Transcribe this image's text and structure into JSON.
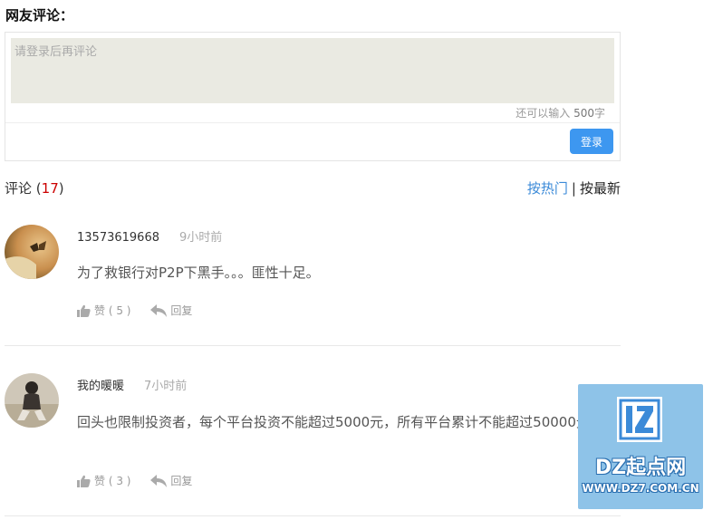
{
  "section": {
    "title": "网友评论："
  },
  "composer": {
    "placeholder": "请登录后再评论",
    "limit_prefix": "还可以输入",
    "limit_count": "500",
    "limit_suffix": "字",
    "login_label": "登录"
  },
  "comments_header": {
    "label": "评论",
    "count": "17",
    "sort_hot": "按热门",
    "sort_sep": "|",
    "sort_new": "按最新"
  },
  "comments": [
    {
      "user": "13573619668",
      "time": "9小时前",
      "text": "为了救银行对P2P下黑手。。。匪性十足。",
      "like_label": "赞",
      "like_count": "( 5 )",
      "reply_label": "回复"
    },
    {
      "user": "我的暖暖",
      "time": "7小时前",
      "text": "回头也限制投资者，每个平台投资不能超过5000元，所有平台累计不能超过50000元。",
      "like_label": "赞",
      "like_count": "( 3 )",
      "reply_label": "回复"
    }
  ],
  "watermark": {
    "name": "DZ起点网",
    "url": "WWW.DZ7.COM.CN",
    "logo_text": "LZ"
  },
  "colors": {
    "accent": "#3d97f0",
    "link": "#3b8ad8",
    "count": "#cc0000",
    "textarea_bg": "#eaeae2",
    "watermark_bg": "#8ec3e8"
  }
}
